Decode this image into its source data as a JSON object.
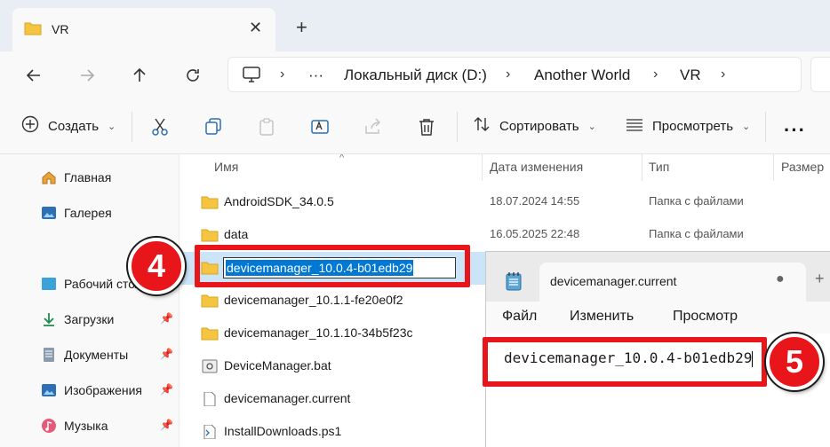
{
  "window": {
    "tab_title": "VR"
  },
  "nav": {
    "breadcrumb": [
      "Локальный диск (D:)",
      "Another World",
      "VR"
    ],
    "ellipsis": "···"
  },
  "commandbar": {
    "create_label": "Создать",
    "sort_label": "Сортировать",
    "view_label": "Просмотреть",
    "more_label": "···"
  },
  "sidebar": {
    "items": [
      {
        "label": "Главная",
        "icon": "home-icon"
      },
      {
        "label": "Галерея",
        "icon": "gallery-icon"
      },
      {
        "label": "Рабочий стол",
        "icon": "desktop-icon",
        "pinned": false
      },
      {
        "label": "Загрузки",
        "icon": "download-icon",
        "pinned": true
      },
      {
        "label": "Документы",
        "icon": "documents-icon",
        "pinned": true
      },
      {
        "label": "Изображения",
        "icon": "pictures-icon",
        "pinned": true
      },
      {
        "label": "Музыка",
        "icon": "music-icon",
        "pinned": true
      }
    ]
  },
  "filelist": {
    "columns": [
      "Имя",
      "Дата изменения",
      "Тип",
      "Размер"
    ],
    "rows": [
      {
        "name": "AndroidSDK_34.0.5",
        "date": "18.07.2024 14:55",
        "type": "Папка с файлами",
        "icon": "folder-icon"
      },
      {
        "name": "data",
        "date": "16.05.2025 22:48",
        "type": "Папка с файлами",
        "icon": "folder-icon"
      },
      {
        "name": "devicemanager_10.0.4-b01edb29",
        "date": "",
        "type": "",
        "icon": "folder-icon",
        "renaming": true
      },
      {
        "name": "devicemanager_10.1.1-fe20e0f2",
        "date": "",
        "type": "",
        "icon": "folder-icon"
      },
      {
        "name": "devicemanager_10.1.10-34b5f23c",
        "date": "",
        "type": "",
        "icon": "folder-icon"
      },
      {
        "name": "DeviceManager.bat",
        "date": "",
        "type": "",
        "icon": "batch-file-icon"
      },
      {
        "name": "devicemanager.current",
        "date": "",
        "type": "",
        "icon": "file-icon"
      },
      {
        "name": "InstallDownloads.ps1",
        "date": "",
        "type": "",
        "icon": "script-file-icon"
      }
    ]
  },
  "notepad": {
    "tab_title": "devicemanager.current",
    "menu": [
      "Файл",
      "Изменить",
      "Просмотр"
    ],
    "content": "devicemanager_10.0.4-b01edb29"
  },
  "annotations": {
    "badge_rename": "4",
    "badge_notepad": "5",
    "color": "#e8161b"
  },
  "colors": {
    "accent": "#0078d4",
    "folder": "#f5c542",
    "selection": "#cce4f7"
  }
}
